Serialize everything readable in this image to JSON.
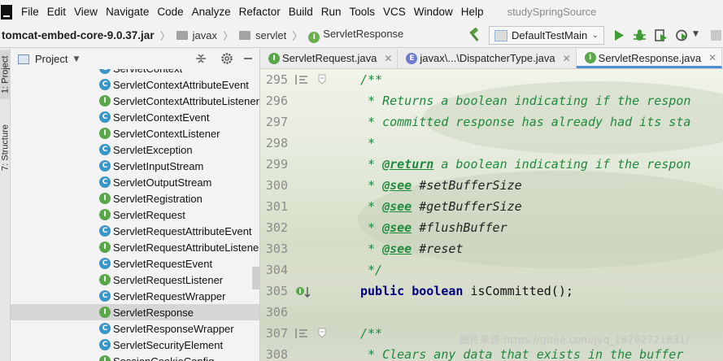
{
  "menu": {
    "items": [
      "File",
      "Edit",
      "View",
      "Navigate",
      "Code",
      "Analyze",
      "Refactor",
      "Build",
      "Run",
      "Tools",
      "VCS",
      "Window",
      "Help"
    ],
    "project_name": "studySpringSource"
  },
  "navbar": {
    "jar": "tomcat-embed-core-9.0.37.jar",
    "crumbs": [
      "javax",
      "servlet",
      "ServletResponse"
    ],
    "run_config": "DefaultTestMain"
  },
  "left_stripe": {
    "project_tab": "1: Project",
    "structure_tab": "7: Structure"
  },
  "project_panel": {
    "title": "Project",
    "tree": [
      {
        "label": "ServletContext",
        "kind": "class",
        "badge": "C"
      },
      {
        "label": "ServletContextAttributeEvent",
        "kind": "class",
        "badge": "C"
      },
      {
        "label": "ServletContextAttributeListener",
        "kind": "interface",
        "badge": "I"
      },
      {
        "label": "ServletContextEvent",
        "kind": "class",
        "badge": "C"
      },
      {
        "label": "ServletContextListener",
        "kind": "interface",
        "badge": "I"
      },
      {
        "label": "ServletException",
        "kind": "class",
        "badge": "C"
      },
      {
        "label": "ServletInputStream",
        "kind": "class",
        "badge": "C"
      },
      {
        "label": "ServletOutputStream",
        "kind": "class",
        "badge": "C"
      },
      {
        "label": "ServletRegistration",
        "kind": "interface",
        "badge": "I"
      },
      {
        "label": "ServletRequest",
        "kind": "interface",
        "badge": "I"
      },
      {
        "label": "ServletRequestAttributeEvent",
        "kind": "class",
        "badge": "C"
      },
      {
        "label": "ServletRequestAttributeListener",
        "kind": "interface",
        "badge": "I"
      },
      {
        "label": "ServletRequestEvent",
        "kind": "class",
        "badge": "C"
      },
      {
        "label": "ServletRequestListener",
        "kind": "interface",
        "badge": "I"
      },
      {
        "label": "ServletRequestWrapper",
        "kind": "class",
        "badge": "C"
      },
      {
        "label": "ServletResponse",
        "kind": "interface",
        "badge": "I",
        "selected": true
      },
      {
        "label": "ServletResponseWrapper",
        "kind": "class",
        "badge": "C"
      },
      {
        "label": "ServletSecurityElement",
        "kind": "class",
        "badge": "C"
      },
      {
        "label": "SessionCookieConfig",
        "kind": "interface",
        "badge": "I"
      }
    ]
  },
  "editor": {
    "tabs": [
      {
        "label": "ServletRequest.java",
        "badge": "I",
        "active": false
      },
      {
        "label": "javax\\...\\DispatcherType.java",
        "badge": "E",
        "active": false
      },
      {
        "label": "ServletResponse.java",
        "badge": "I",
        "active": true
      }
    ],
    "line_numbers": [
      "295",
      "296",
      "297",
      "298",
      "299",
      "300",
      "301",
      "302",
      "303",
      "304",
      "305",
      "306",
      "307",
      "308"
    ],
    "lines": {
      "l295": "/**",
      "l296_prefix": " * ",
      "l296_text": "Returns a boolean indicating if the respon",
      "l297_prefix": " * ",
      "l297_text": "committed response has already had its sta",
      "l298": " *",
      "l299_prefix": " * ",
      "l299_tag": "@return",
      "l299_text": " a boolean indicating if the respon",
      "l300_prefix": " * ",
      "l300_tag": "@see",
      "l300_ref": " #setBufferSize",
      "l301_prefix": " * ",
      "l301_tag": "@see",
      "l301_ref": " #getBufferSize",
      "l302_prefix": " * ",
      "l302_tag": "@see",
      "l302_ref": " #flushBuffer",
      "l303_prefix": " * ",
      "l303_tag": "@see",
      "l303_ref": " #reset",
      "l304": " */",
      "l305_kw1": "public",
      "l305_kw2": "boolean",
      "l305_rest": " isCommitted();",
      "l307": "/**",
      "l308_prefix": " * ",
      "l308_text": "Clears any data that exists in the buffer"
    },
    "watermark": "图片来源:https://gitee.com/jyq_18792721831/"
  },
  "colors": {
    "comment": "#1f8a3e",
    "keyword": "#000080",
    "selection": "#d6d6d6",
    "class_badge": "#3a95c8",
    "interface_badge": "#5aa64a",
    "active_tab_underline": "#4e8fd8"
  }
}
